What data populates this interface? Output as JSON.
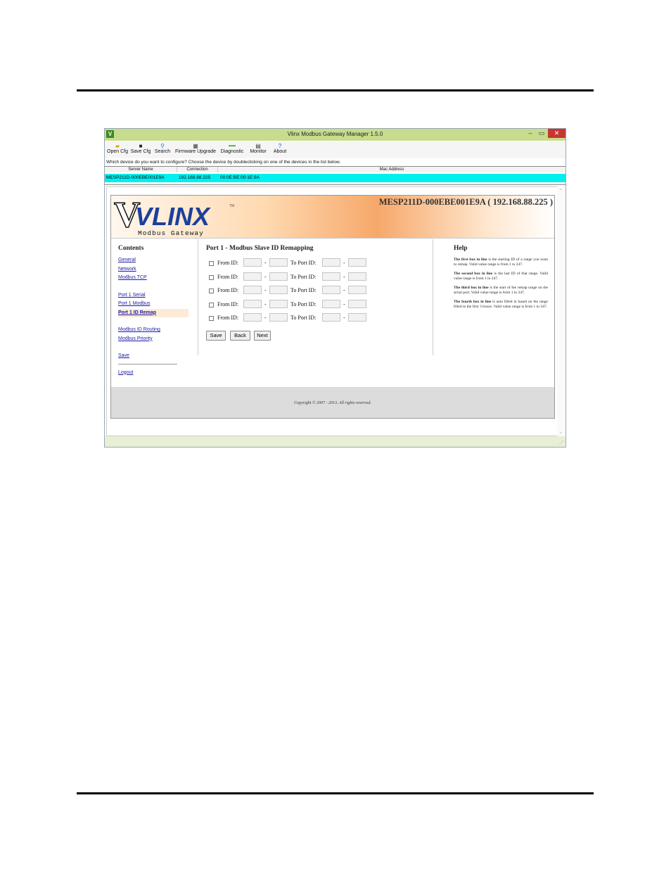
{
  "window": {
    "title": "Vlinx Modbus Gateway Manager 1.5.0",
    "app_icon": "V",
    "controls": {
      "minimize": "–",
      "maximize": "▭",
      "close": "✕"
    }
  },
  "toolbar": {
    "items": [
      {
        "label": "Open Cfg",
        "icon": "folder-icon"
      },
      {
        "label": "Save Cfg",
        "icon": "floppy-icon"
      },
      {
        "label": "Search",
        "icon": "magnifier-icon"
      },
      {
        "label": "Firmware Upgrade",
        "icon": "chip-icon"
      },
      {
        "label": "Diagnostic",
        "icon": "diagnostic-icon"
      },
      {
        "label": "Monitor",
        "icon": "monitor-icon"
      },
      {
        "label": "About",
        "icon": "question-icon"
      }
    ]
  },
  "prompt": "Which device do you want to configure? Choose the device by doubleclicking on one of the devices in the list below.",
  "device_list": {
    "columns": [
      "Server Name",
      "Connection",
      "Mac Address"
    ],
    "rows": [
      {
        "server_name": "MESP211D-000EBE001E9A",
        "connection": "192.168.88.225",
        "mac": "00:0E:BE:00:1E:9A"
      }
    ]
  },
  "banner": {
    "logo": "VLINX",
    "tm": "TM",
    "subtitle": "Modbus Gateway",
    "device_title": "MESP211D-000EBE001E9A ( 192.168.88.225 )"
  },
  "nav": {
    "heading": "Contents",
    "group1": [
      "General",
      "Network",
      "Modbus TCP"
    ],
    "group2": [
      "Port 1 Serial",
      "Port 1 Modbus",
      "Port 1 ID Remap"
    ],
    "group3": [
      "Modbus ID Routing",
      "Modbus Priority"
    ],
    "save": "Save",
    "logout": "Logout",
    "active": "Port 1 ID Remap"
  },
  "main": {
    "heading": "Port 1 - Modbus Slave ID Remapping",
    "from_label": "From ID:",
    "to_label": "To Port ID:",
    "dash": "-",
    "rows": [
      {
        "checked": false,
        "from_start": "",
        "from_end": "",
        "to_start": "",
        "to_end": ""
      },
      {
        "checked": false,
        "from_start": "",
        "from_end": "",
        "to_start": "",
        "to_end": ""
      },
      {
        "checked": false,
        "from_start": "",
        "from_end": "",
        "to_start": "",
        "to_end": ""
      },
      {
        "checked": false,
        "from_start": "",
        "from_end": "",
        "to_start": "",
        "to_end": ""
      },
      {
        "checked": false,
        "from_start": "",
        "from_end": "",
        "to_start": "",
        "to_end": ""
      }
    ],
    "buttons": {
      "save": "Save",
      "back": "Back",
      "next": "Next"
    }
  },
  "help": {
    "heading": "Help",
    "p1_bold": "The first box in line",
    "p1_rest": " is the starting ID of a range you want to remap. Valid value range is from 1 to 247.",
    "p2_bold": "The second box in line",
    "p2_rest": " is the last ID of that range. Valid value range is from 1 to 247.",
    "p3_bold": "The third box in line",
    "p3_rest": " is the start of the remap range on the serial port. Valid value range is from 1 to 247.",
    "p4_bold": "The fourth box in line",
    "p4_rest": " is auto filled in based on the range filled in the first 3 boxes. Valid value range is from 1 to 247."
  },
  "footer": {
    "copyright": "Copyright © 2007 - 2013. All rights reserved."
  },
  "colors": {
    "titlebar": "#c7dc8c",
    "selected_row": "#00f0f0",
    "link": "#1a1aa8",
    "close_button": "#c7362f"
  }
}
